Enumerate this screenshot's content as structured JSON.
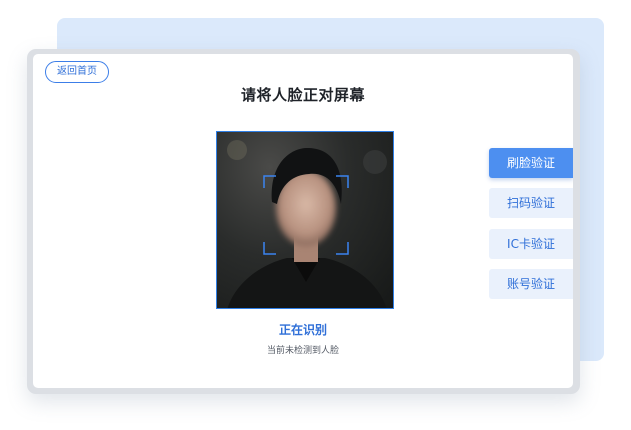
{
  "header": {
    "back_label": "返回首页",
    "title": "请将人脸正对屏幕"
  },
  "status": {
    "main": "正在识别",
    "sub": "当前未检测到人脸"
  },
  "side_menu": {
    "items": [
      {
        "label": "刷脸验证",
        "active": true
      },
      {
        "label": "扫码验证",
        "active": false
      },
      {
        "label": "IC卡验证",
        "active": false
      },
      {
        "label": "账号验证",
        "active": false
      }
    ]
  },
  "colors": {
    "accent": "#2f6fd8",
    "active_bg": "#4d8ff0",
    "button_bg": "#eaf1fc",
    "back_panel": "#dbe9fb"
  }
}
